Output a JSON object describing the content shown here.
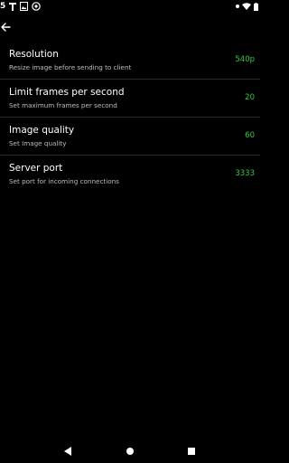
{
  "status_bar": {
    "left_text": "5",
    "left_icons": [
      "t-app-icon",
      "image-icon",
      "at-sign-icon"
    ],
    "right_icons": [
      "dot-icon",
      "wifi-icon",
      "battery-icon"
    ]
  },
  "toolbar": {
    "back_icon": "back-arrow-icon"
  },
  "settings": [
    {
      "title": "Resolution",
      "subtitle": "Resize image before sending to client",
      "value": "540p"
    },
    {
      "title": "Limit frames per second",
      "subtitle": "Set maximum frames per second",
      "value": "20"
    },
    {
      "title": "Image quality",
      "subtitle": "Set Image quality",
      "value": "60"
    },
    {
      "title": "Server port",
      "subtitle": "Set port for incoming connections",
      "value": "3333"
    }
  ],
  "colors": {
    "background": "#000000",
    "value": "#2ecc40",
    "subtitle": "#bdbdbd"
  },
  "nav_bar": {
    "icons": [
      "back-triangle-icon",
      "home-circle-icon",
      "recents-square-icon"
    ]
  }
}
